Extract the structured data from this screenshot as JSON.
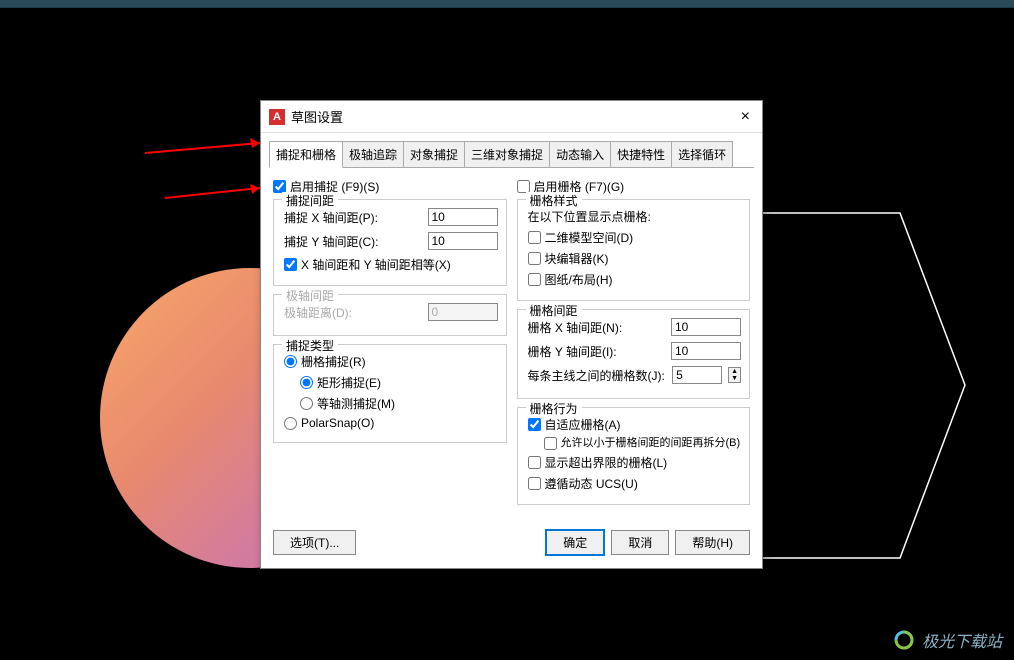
{
  "dialog": {
    "icon_letter": "A",
    "title": "草图设置",
    "close": "×"
  },
  "tabs": [
    "捕捉和栅格",
    "极轴追踪",
    "对象捕捉",
    "三维对象捕捉",
    "动态输入",
    "快捷特性",
    "选择循环"
  ],
  "left": {
    "enable_snap": "启用捕捉 (F9)(S)",
    "snap_spacing_title": "捕捉间距",
    "snap_x_label": "捕捉 X 轴间距(P):",
    "snap_x_value": "10",
    "snap_y_label": "捕捉 Y 轴间距(C):",
    "snap_y_value": "10",
    "equal_xy": "X 轴间距和 Y 轴间距相等(X)",
    "polar_spacing_title": "极轴间距",
    "polar_dist_label": "极轴距离(D):",
    "polar_dist_value": "0",
    "snap_type_title": "捕捉类型",
    "grid_snap": "栅格捕捉(R)",
    "rect_snap": "矩形捕捉(E)",
    "iso_snap": "等轴测捕捉(M)",
    "polar_snap": "PolarSnap(O)"
  },
  "right": {
    "enable_grid": "启用栅格 (F7)(G)",
    "grid_style_title": "栅格样式",
    "grid_style_desc": "在以下位置显示点栅格:",
    "model_space": "二维模型空间(D)",
    "block_editor": "块编辑器(K)",
    "paper_layout": "图纸/布局(H)",
    "grid_spacing_title": "栅格间距",
    "grid_x_label": "栅格 X 轴间距(N):",
    "grid_x_value": "10",
    "grid_y_label": "栅格 Y 轴间距(I):",
    "grid_y_value": "10",
    "major_line_label": "每条主线之间的栅格数(J):",
    "major_line_value": "5",
    "grid_behavior_title": "栅格行为",
    "adaptive": "自适应栅格(A)",
    "subdivide": "允许以小于栅格间距的间距再拆分(B)",
    "beyond": "显示超出界限的栅格(L)",
    "follow_ucs": "遵循动态 UCS(U)"
  },
  "buttons": {
    "options": "选项(T)...",
    "ok": "确定",
    "cancel": "取消",
    "help": "帮助(H)"
  },
  "watermark": "极光下载站"
}
